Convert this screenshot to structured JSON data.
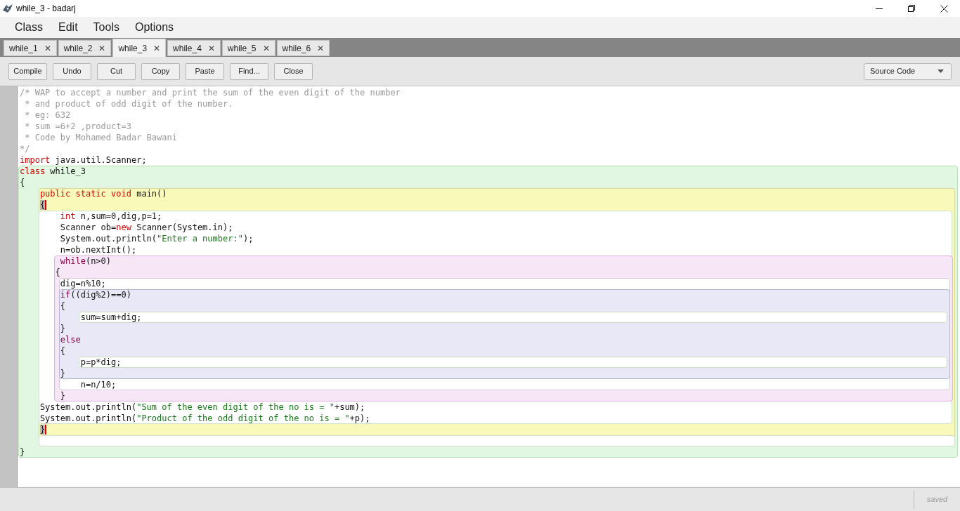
{
  "window": {
    "title": "while_3 - badarj"
  },
  "menu": [
    "Class",
    "Edit",
    "Tools",
    "Options"
  ],
  "tabs": [
    {
      "label": "while_1",
      "selected": false
    },
    {
      "label": "while_2",
      "selected": false
    },
    {
      "label": "while_3",
      "selected": true
    },
    {
      "label": "while_4",
      "selected": false
    },
    {
      "label": "while_5",
      "selected": false
    },
    {
      "label": "while_6",
      "selected": false
    }
  ],
  "tab_close": "✕",
  "toolbar": [
    "Compile",
    "Undo",
    "Cut",
    "Copy",
    "Paste",
    "Find...",
    "Close"
  ],
  "view_select": {
    "value": "Source Code"
  },
  "editor": {
    "lines": [
      [
        {
          "kind": "comment",
          "text": "/* WAP to accept a number and print the sum of the even digit of the number"
        }
      ],
      [
        {
          "kind": "comment",
          "text": " * and product of odd digit of the number."
        }
      ],
      [
        {
          "kind": "comment",
          "text": " * eg: 632"
        }
      ],
      [
        {
          "kind": "comment",
          "text": " * sum =6+2 ,product=3"
        }
      ],
      [
        {
          "kind": "comment",
          "text": " * Code by Mohamed Badar Bawani"
        }
      ],
      [
        {
          "kind": "comment",
          "text": "*/"
        }
      ],
      [
        {
          "kind": "keyword",
          "text": "import"
        },
        {
          "kind": "plain",
          "text": " java.util.Scanner;"
        }
      ],
      [
        {
          "kind": "keyword",
          "text": "class"
        },
        {
          "kind": "plain",
          "text": " while_3"
        }
      ],
      [
        {
          "kind": "plain",
          "text": "{"
        }
      ],
      [
        {
          "kind": "keyword",
          "text": "    public static void"
        },
        {
          "kind": "plain",
          "text": " main()"
        }
      ],
      [
        {
          "kind": "matched",
          "text": "    {"
        }
      ],
      [
        {
          "kind": "keyword",
          "text": "        int"
        },
        {
          "kind": "plain",
          "text": " n,sum=0,dig,p=1;"
        }
      ],
      [
        {
          "kind": "plain",
          "text": "        Scanner ob="
        },
        {
          "kind": "keyword",
          "text": "new"
        },
        {
          "kind": "plain",
          "text": " Scanner(System.in);"
        }
      ],
      [
        {
          "kind": "plain",
          "text": "        System.out.println("
        },
        {
          "kind": "string",
          "text": "\"Enter a number:\""
        },
        {
          "kind": "plain",
          "text": ");"
        }
      ],
      [
        {
          "kind": "plain",
          "text": "        n=ob.nextInt();"
        }
      ],
      [
        {
          "kind": "control",
          "text": "        while"
        },
        {
          "kind": "plain",
          "text": "(n>0)"
        }
      ],
      [
        {
          "kind": "plain",
          "text": "       {"
        }
      ],
      [
        {
          "kind": "plain",
          "text": "        dig=n%10;"
        }
      ],
      [
        {
          "kind": "control",
          "text": "        if"
        },
        {
          "kind": "plain",
          "text": "((dig%2)==0)"
        }
      ],
      [
        {
          "kind": "plain",
          "text": "        {"
        }
      ],
      [
        {
          "kind": "plain",
          "text": "            sum=sum+dig;"
        }
      ],
      [
        {
          "kind": "plain",
          "text": "        }"
        }
      ],
      [
        {
          "kind": "control",
          "text": "        else"
        }
      ],
      [
        {
          "kind": "plain",
          "text": "        {"
        }
      ],
      [
        {
          "kind": "plain",
          "text": "            p=p*dig;"
        }
      ],
      [
        {
          "kind": "plain",
          "text": "        }"
        }
      ],
      [
        {
          "kind": "plain",
          "text": "            n=n/10;"
        }
      ],
      [
        {
          "kind": "plain",
          "text": "        }"
        }
      ],
      [
        {
          "kind": "plain",
          "text": "    System.out.println("
        },
        {
          "kind": "string",
          "text": "\"Sum of the even digit of the no is = \""
        },
        {
          "kind": "plain",
          "text": "+sum);"
        }
      ],
      [
        {
          "kind": "plain",
          "text": "    System.out.println("
        },
        {
          "kind": "string",
          "text": "\"Product of the odd digit of the no is = \""
        },
        {
          "kind": "plain",
          "text": "+p);"
        }
      ],
      [
        {
          "kind": "matched",
          "text": "    }"
        }
      ],
      [
        {
          "kind": "plain",
          "text": "}"
        }
      ]
    ]
  },
  "status_bar": {
    "text": "saved"
  }
}
